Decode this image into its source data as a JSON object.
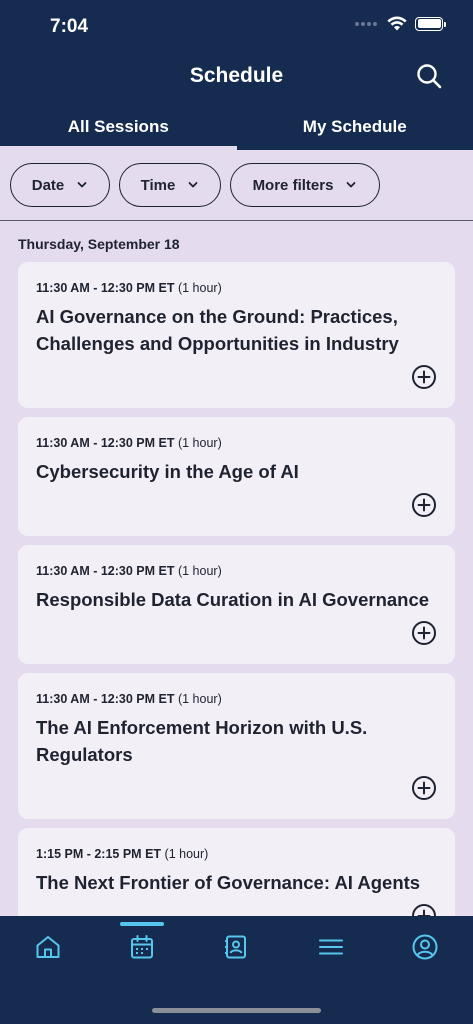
{
  "status": {
    "time": "7:04"
  },
  "header": {
    "title": "Schedule"
  },
  "tabs": [
    {
      "label": "All Sessions",
      "active": true
    },
    {
      "label": "My Schedule",
      "active": false
    }
  ],
  "filters": [
    {
      "label": "Date"
    },
    {
      "label": "Time"
    },
    {
      "label": "More filters"
    }
  ],
  "date_heading": "Thursday, September 18",
  "sessions": [
    {
      "time": "11:30 AM - 12:30 PM ET",
      "duration": "(1 hour)",
      "title": "AI Governance on the Ground: Practices, Challenges and Opportunities in Industry"
    },
    {
      "time": "11:30 AM - 12:30 PM ET",
      "duration": "(1 hour)",
      "title": "Cybersecurity in the Age of AI"
    },
    {
      "time": "11:30 AM - 12:30 PM ET",
      "duration": "(1 hour)",
      "title": "Responsible Data Curation in AI Governance"
    },
    {
      "time": "11:30 AM - 12:30 PM ET",
      "duration": "(1 hour)",
      "title": "The AI Enforcement Horizon with U.S. Regulators"
    },
    {
      "time": "1:15 PM - 2:15 PM ET",
      "duration": "(1 hour)",
      "title": "The Next Frontier of Governance: AI Agents"
    }
  ],
  "tabbar": {
    "items": [
      {
        "icon": "home-icon"
      },
      {
        "icon": "calendar-icon",
        "active": true
      },
      {
        "icon": "contacts-icon"
      },
      {
        "icon": "menu-icon"
      },
      {
        "icon": "profile-icon"
      }
    ]
  },
  "colors": {
    "navy": "#152c50",
    "lavender": "#e5dbee",
    "card": "#f2eff7",
    "accent": "#56c6ee"
  }
}
